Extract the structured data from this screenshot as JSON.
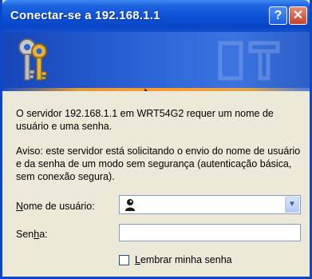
{
  "window": {
    "title": "Conectar-se a 192.168.1.1",
    "help_label": "?",
    "close_label": "✕"
  },
  "icons": {
    "banner": "keys-icon",
    "watermark": "server-watermark-icon",
    "cursor": "mouse-cursor-icon",
    "user": "user-icon",
    "dropdown": "chevron-down-icon"
  },
  "message": {
    "line1": "O servidor 192.168.1.1 em WRT54G2 requer um nome de usuário e uma senha.",
    "line2": "Aviso: este servidor está solicitando o envio do nome de usuário e da senha de um modo sem segurança (autenticação básica, sem conexão segura)."
  },
  "form": {
    "username_label_first": "N",
    "username_label_rest": "ome de usuário:",
    "username_value": "",
    "password_label_start": "Sen",
    "password_label_underlined": "h",
    "password_label_end": "a:",
    "password_value": "",
    "remember_underlined": "L",
    "remember_rest": "embrar minha senha",
    "remember_checked": false
  },
  "colors": {
    "titlebar": "#0b4fd6",
    "banner": "#2a63d6",
    "stripe_accent": "#ff9c2a",
    "body": "#ece9d8"
  }
}
